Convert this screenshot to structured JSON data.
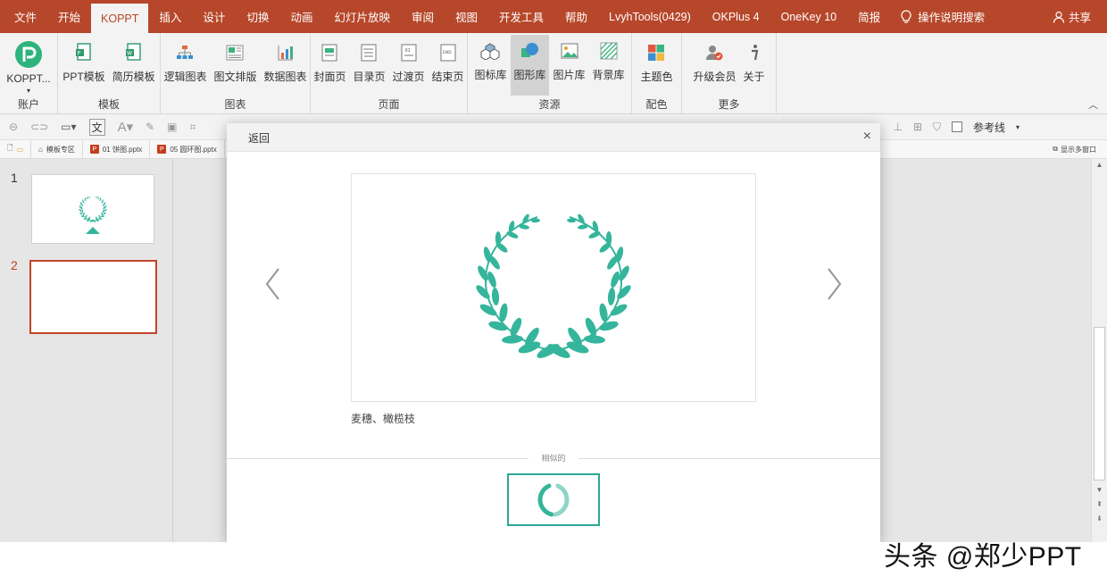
{
  "tabs": [
    "文件",
    "开始",
    "KOPPT",
    "插入",
    "设计",
    "切换",
    "动画",
    "幻灯片放映",
    "审阅",
    "视图",
    "开发工具",
    "帮助",
    "LvyhTools(0429)",
    "OKPlus 4",
    "OneKey 10",
    "简报"
  ],
  "active_tab": "KOPPT",
  "help_search": "操作说明搜索",
  "share": "共享",
  "ribbon": {
    "account": {
      "button": "KOPPT...",
      "label": "账户"
    },
    "template": {
      "buttons": [
        "PPT模板",
        "简历模板"
      ],
      "label": "模板"
    },
    "chart": {
      "buttons": [
        "逻辑图表",
        "图文排版",
        "数据图表"
      ],
      "label": "图表"
    },
    "page": {
      "buttons": [
        "封面页",
        "目录页",
        "过渡页",
        "结束页"
      ],
      "label": "页面"
    },
    "resource": {
      "buttons": [
        "图标库",
        "图形库",
        "图片库",
        "背景库"
      ],
      "label": "资源",
      "pressed": "图形库"
    },
    "color": {
      "buttons": [
        "主题色"
      ],
      "label": "配色"
    },
    "more": {
      "buttons": [
        "升级会员",
        "关于"
      ],
      "label": "更多"
    }
  },
  "quick_toolbar": {
    "guides": "参考线"
  },
  "doc_tabs": [
    "模板专区",
    "01 饼图.pptx",
    "05 圆环图.pptx"
  ],
  "doc_tabs_more": "显示多窗口",
  "slides": [
    "1",
    "2"
  ],
  "selected_slide": "2",
  "dialog": {
    "back": "返回",
    "close": "×",
    "caption": "麦穗、橄榄枝",
    "similar_label": "相似的"
  },
  "colors": {
    "accent": "#b7472a",
    "teal": "#35b59b"
  },
  "watermark": "头条 @郑少PPT"
}
